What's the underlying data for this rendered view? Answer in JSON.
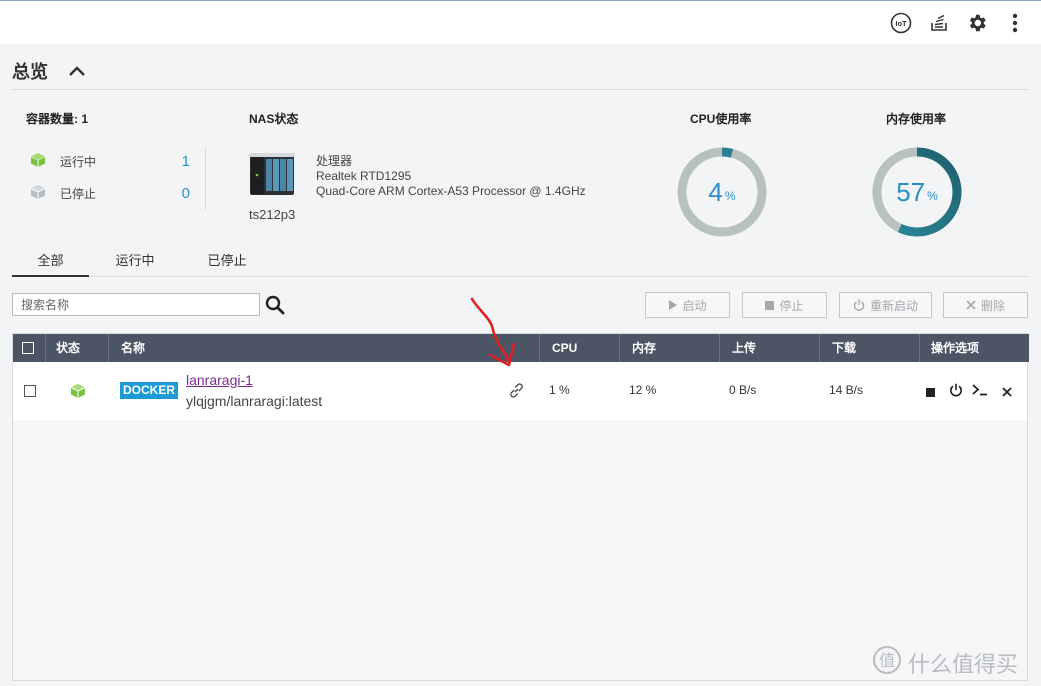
{
  "header": {
    "icons": [
      "iot-icon",
      "stack-icon",
      "gear-icon",
      "more-icon"
    ],
    "iot_label": "IoT"
  },
  "overview": {
    "title": "总览"
  },
  "containers": {
    "count_label": "容器数量: 1",
    "running_label": "运行中",
    "running_count": "1",
    "stopped_label": "已停止",
    "stopped_count": "0"
  },
  "nas": {
    "title": "NAS状态",
    "name": "ts212p3",
    "processor_label": "处理器",
    "processor_model": "Realtek RTD1295",
    "processor_desc": "Quad-Core ARM Cortex-A53 Processor @ 1.4GHz"
  },
  "cpu": {
    "title": "CPU使用率",
    "value": "4",
    "unit": "%",
    "fraction": 0.04
  },
  "memory": {
    "title": "内存使用率",
    "value": "57",
    "unit": "%",
    "fraction": 0.57
  },
  "tabs": [
    {
      "label": "全部",
      "active": true
    },
    {
      "label": "运行中",
      "active": false
    },
    {
      "label": "已停止",
      "active": false
    }
  ],
  "search": {
    "placeholder": "搜索名称"
  },
  "actions": {
    "start": "启动",
    "stop": "停止",
    "restart": "重新启动",
    "delete": "删除"
  },
  "table": {
    "columns": [
      "状态",
      "名称",
      "CPU",
      "内存",
      "上传",
      "下载",
      "操作选项"
    ],
    "rows": [
      {
        "type_badge": "DOCKER",
        "name": "lanraragi-1",
        "image": "ylqjgm/lanraragi:latest",
        "cpu": "1 %",
        "memory": "12 %",
        "upload": "0 B/s",
        "download": "14 B/s"
      }
    ]
  },
  "watermark": {
    "text": "什么值得买",
    "logo_glyph": "值"
  },
  "colors": {
    "accent": "#2a8fc8",
    "header_bg": "#4c5566",
    "running_green": "#7cc242",
    "gauge_cpu": "#2d7f93",
    "gauge_mem": "#2b8a9c",
    "gauge_track": "#b7c1c0",
    "annotation_red": "#e02020"
  }
}
